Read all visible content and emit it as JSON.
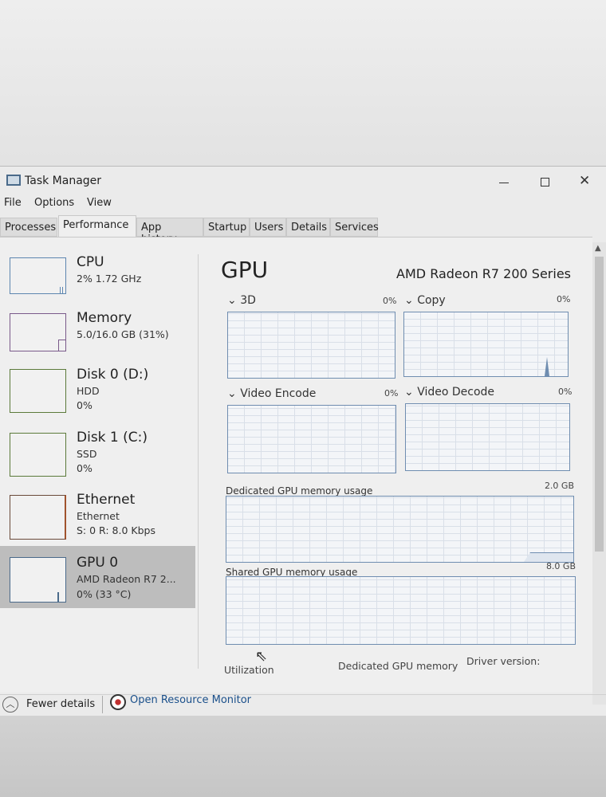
{
  "window": {
    "title": "Task Manager",
    "controls": {
      "minimize": "minimize-icon",
      "maximize": "maximize-icon",
      "close": "close-icon"
    }
  },
  "menu": [
    "File",
    "Options",
    "View"
  ],
  "tabs": [
    "Processes",
    "Performance",
    "App history",
    "Startup",
    "Users",
    "Details",
    "Services"
  ],
  "active_tab": "Performance",
  "sidebar": [
    {
      "title": "CPU",
      "sub1": "2% 1.72 GHz",
      "sub2": ""
    },
    {
      "title": "Memory",
      "sub1": "5.0/16.0 GB (31%)",
      "sub2": ""
    },
    {
      "title": "Disk 0 (D:)",
      "sub1": "HDD",
      "sub2": "0%"
    },
    {
      "title": "Disk 1 (C:)",
      "sub1": "SSD",
      "sub2": "0%"
    },
    {
      "title": "Ethernet",
      "sub1": "Ethernet",
      "sub2": "S: 0 R: 8.0 Kbps"
    },
    {
      "title": "GPU 0",
      "sub1": "AMD Radeon R7 2...",
      "sub2": "0% (33 °C)",
      "selected": true
    }
  ],
  "main": {
    "title": "GPU",
    "device": "AMD Radeon R7 200 Series",
    "engines": [
      {
        "label": "3D",
        "value": "0%"
      },
      {
        "label": "Copy",
        "value": "0%"
      },
      {
        "label": "Video Encode",
        "value": "0%"
      },
      {
        "label": "Video Decode",
        "value": "0%"
      }
    ],
    "dedicated": {
      "label": "Dedicated GPU memory usage",
      "max": "2.0 GB"
    },
    "shared": {
      "label": "Shared GPU memory usage",
      "max": "8.0 GB"
    },
    "stats": {
      "utilization": "Utilization",
      "dedicated_memory": "Dedicated GPU memory",
      "driver_version": "Driver version:"
    }
  },
  "footer": {
    "fewer_details": "Fewer details",
    "resource_monitor": "Open Resource Monitor"
  },
  "colors": {
    "gpu_line": "#6f8db0",
    "ethernet_line": "#a0522d",
    "selected_bg": "#bdbdbd",
    "link": "#1a4f8a"
  }
}
